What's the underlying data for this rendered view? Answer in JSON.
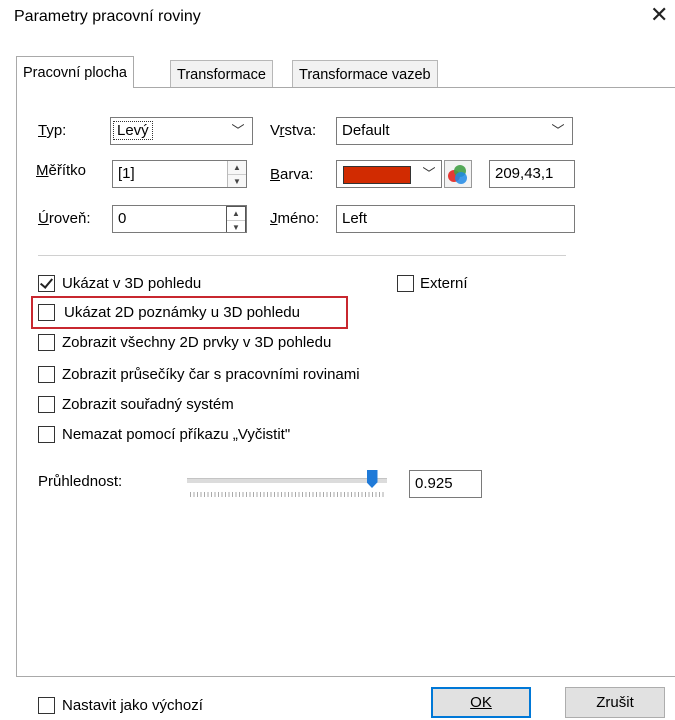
{
  "window": {
    "title": "Parametry pracovní roviny",
    "close_glyph": "✕"
  },
  "tabs": [
    {
      "label": "Pracovní plocha",
      "active": true
    },
    {
      "label": "Transformace",
      "active": false
    },
    {
      "label": "Transformace vazeb",
      "active": false
    }
  ],
  "fields": {
    "typ": {
      "label": "Typ:",
      "value": "Levý"
    },
    "meritko": {
      "label": "Měřítko",
      "value": "[1]"
    },
    "uroven": {
      "label": "Úroveň:",
      "value": "0"
    },
    "vrstva": {
      "label": "Vrstva:",
      "value": "Default"
    },
    "barva": {
      "label": "Barva:",
      "color": "#d12b01",
      "rgb_text": "209,43,1"
    },
    "jmeno": {
      "label": "Jméno:",
      "value": "Left"
    }
  },
  "checkboxes": {
    "show_3d": {
      "label": "Ukázat v 3D pohledu",
      "checked": true
    },
    "external": {
      "label": "Externí",
      "checked": false
    },
    "show_2d_notes": {
      "label": "Ukázat 2D poznámky u 3D pohledu",
      "checked": false
    },
    "show_all_2d": {
      "label": "Zobrazit všechny 2D prvky v 3D pohledu",
      "checked": false
    },
    "show_intersections": {
      "label": "Zobrazit průsečíky čar s pracovními rovinami",
      "checked": false
    },
    "show_coords": {
      "label": "Zobrazit souřadný systém",
      "checked": false
    },
    "no_clean": {
      "label": "Nemazat pomocí příkazu „Vyčistit\"",
      "checked": false
    },
    "set_default": {
      "label": "Nastavit jako výchozí",
      "checked": false
    }
  },
  "transparency": {
    "label": "Průhlednost:",
    "value": "0.925",
    "fraction": 0.925
  },
  "buttons": {
    "ok": "OK",
    "cancel": "Zrušit"
  },
  "colors": {
    "highlight_border": "#c8272f",
    "slider_thumb": "#1f7ad8",
    "default_button_border": "#0078d7"
  }
}
